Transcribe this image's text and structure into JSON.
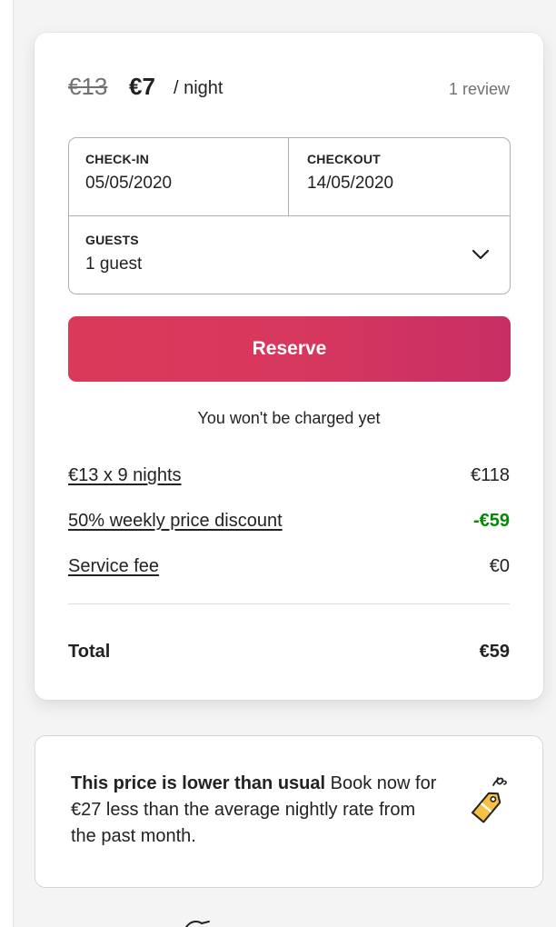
{
  "booking": {
    "original_price": "€13",
    "discounted_price": "€7",
    "per_night": "/ night",
    "reviews": "1 review",
    "checkin": {
      "label": "CHECK-IN",
      "value": "05/05/2020"
    },
    "checkout": {
      "label": "CHECKOUT",
      "value": "14/05/2020"
    },
    "guests": {
      "label": "GUESTS",
      "value": "1 guest",
      "icon": "chevron-down-icon"
    },
    "reserve_label": "Reserve",
    "no_charge_note": "You won't be charged yet",
    "line_items": [
      {
        "label": "€13 x 9 nights",
        "amount": "€118"
      },
      {
        "label": "50% weekly price discount",
        "amount": "-€59"
      },
      {
        "label": "Service fee",
        "amount": "€0"
      }
    ],
    "total": {
      "label": "Total",
      "amount": "€59"
    }
  },
  "price_notice": {
    "headline": "This price is lower than usual",
    "body": "Book now for €27 less than the average nightly rate from the past month.",
    "icon": "price-tag-icon"
  },
  "colors": {
    "brand_gradient_start": "#da3a5a",
    "brand_gradient_end": "#c82e65",
    "discount_green": "#008a05",
    "tag_yellow": "#f5c145"
  }
}
